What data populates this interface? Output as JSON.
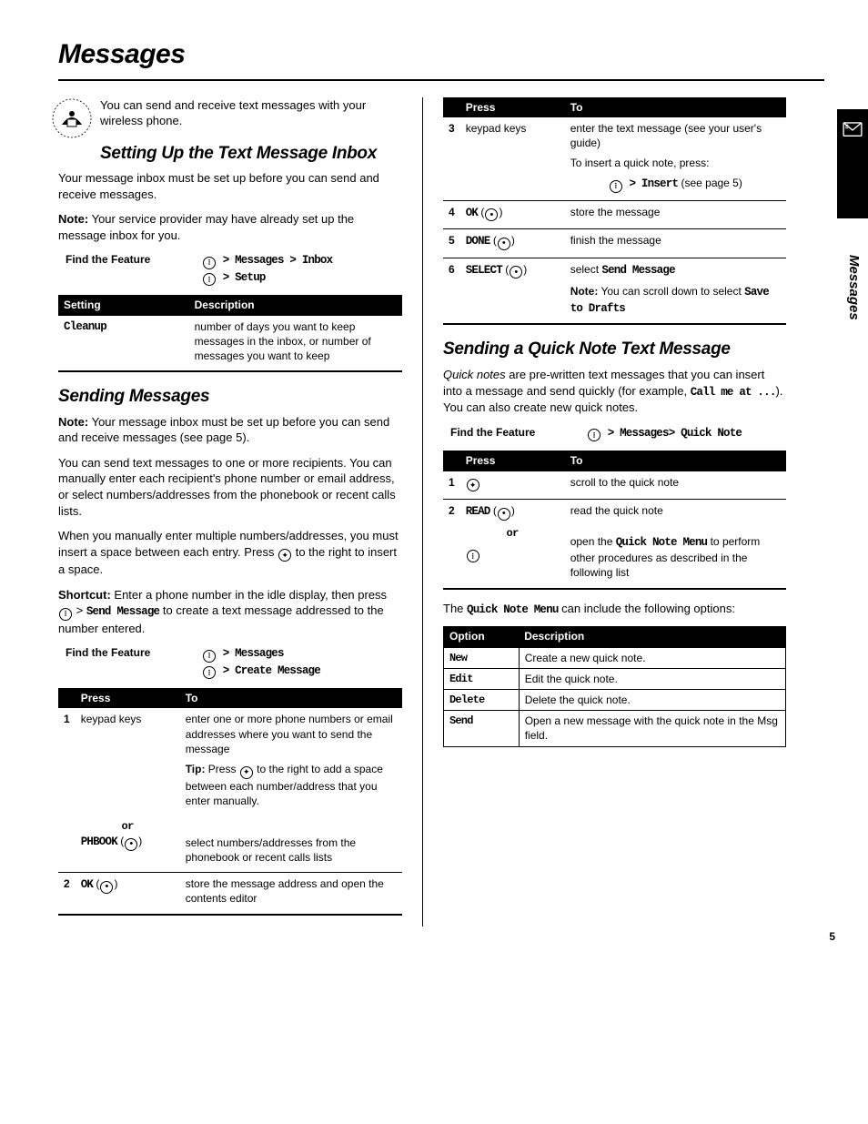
{
  "page_title": "Messages",
  "side_label": "Messages",
  "page_number": "5",
  "intro_text": "You can send and receive text messages with your wireless phone.",
  "section1": {
    "title": "Setting Up the Text Message Inbox",
    "p1": "Your message inbox must be set up before you can send and receive messages.",
    "note_label": "Note:",
    "note_text": " Your service provider may have already set up the message inbox for you.",
    "find_label": "Find the Feature",
    "path_line1": " > Messages > Inbox",
    "path_line2": " > Setup",
    "table": {
      "headers": [
        "Setting",
        "Description"
      ],
      "rows": [
        {
          "setting": "Cleanup",
          "desc": "number of days you want to keep messages in the inbox, or number of messages you want to keep"
        }
      ]
    }
  },
  "section2": {
    "title": "Sending Messages",
    "note_label": "Note:",
    "note_text": " Your message inbox must be set up before you can send and receive messages (see page 5).",
    "p1": "You can send text messages to one or more recipients. You can manually enter each recipient's phone number or email address, or select numbers/addresses from the phonebook or recent calls lists.",
    "p2a": "When you manually enter multiple numbers/addresses, you must insert a space between each entry. Press ",
    "p2b": " to the right to insert a space.",
    "shortcut_label": "Shortcut:",
    "shortcut_a": " Enter a phone number in the idle display, then press ",
    "shortcut_b": " > ",
    "shortcut_cmd": "Send Message",
    "shortcut_c": " to create a text message addressed to the number entered.",
    "find_label": "Find the Feature",
    "path_line1": " > Messages",
    "path_line2": " > Create Message",
    "table": {
      "headers": [
        "",
        "Press",
        "To"
      ],
      "rows": [
        {
          "n": "1",
          "press": "keypad keys",
          "to": "enter one or more phone numbers or email addresses where you want to send the message",
          "tip_label": "Tip:",
          "tip_a": " Press ",
          "tip_b": " to the right to add a space between each number/address that you enter manually."
        },
        {
          "n": "",
          "or": "or",
          "press_mono": "PHBOOK",
          "press_suffix": " (",
          "press_close": ")",
          "to": "select numbers/addresses from the phonebook or recent calls lists"
        },
        {
          "n": "2",
          "press_mono": "OK",
          "press_suffix": " (",
          "press_close": ")",
          "to": "store the message address and open the contents editor"
        },
        {
          "n": "3",
          "press": "keypad keys",
          "to": "enter the text message (see your user's guide)",
          "extra_a": "To insert a quick note, press:",
          "extra_cmd": " > Insert",
          "extra_b": " (see page 5)"
        },
        {
          "n": "4",
          "press_mono": "OK",
          "press_suffix": " (",
          "press_close": ")",
          "to": "store the message"
        },
        {
          "n": "5",
          "press_mono": "DONE",
          "press_suffix": " (",
          "press_close": ")",
          "to": "finish the message"
        },
        {
          "n": "6",
          "press_mono": "SELECT",
          "press_suffix": " (",
          "press_close": ")",
          "to_a": "select ",
          "to_cmd": "Send Message",
          "note_label": "Note:",
          "note_a": " You can scroll down to select ",
          "note_cmd": "Save to Drafts"
        }
      ]
    }
  },
  "section3": {
    "title": "Sending a Quick Note Text Message",
    "p1a_italic": "Quick notes",
    "p1a": " are pre-written text messages that you can insert into a message and send quickly (for example, ",
    "p1_cmd": "Call me at ...",
    "p1b": "). You can also create new quick notes.",
    "find_label": "Find the Feature",
    "path_line1": " > Messages",
    "path_line1b": "> Quick Note",
    "table": {
      "headers": [
        "",
        "Press",
        "To"
      ],
      "rows": [
        {
          "n": "1",
          "press_icon": "nav",
          "to": "scroll to the quick note"
        },
        {
          "n": "2",
          "press_mono": "READ",
          "press_suffix": " (",
          "press_close": ")",
          "to": "read the quick note",
          "or": "or",
          "alt_icon": "menu",
          "alt_to_a": "open the ",
          "alt_cmd": "Quick Note Menu",
          "alt_to_b": " to perform other procedures as described in the following list"
        }
      ]
    },
    "after_a": "The ",
    "after_cmd": "Quick Note Menu",
    "after_b": " can include the following options:",
    "options": {
      "headers": [
        "Option",
        "Description"
      ],
      "rows": [
        {
          "opt": "New",
          "desc": "Create a new quick note."
        },
        {
          "opt": "Edit",
          "desc": "Edit the quick note."
        },
        {
          "opt": "Delete",
          "desc": "Delete the quick note."
        },
        {
          "opt": "Send",
          "desc": "Open a new message with the quick note in the Msg field."
        }
      ]
    }
  }
}
